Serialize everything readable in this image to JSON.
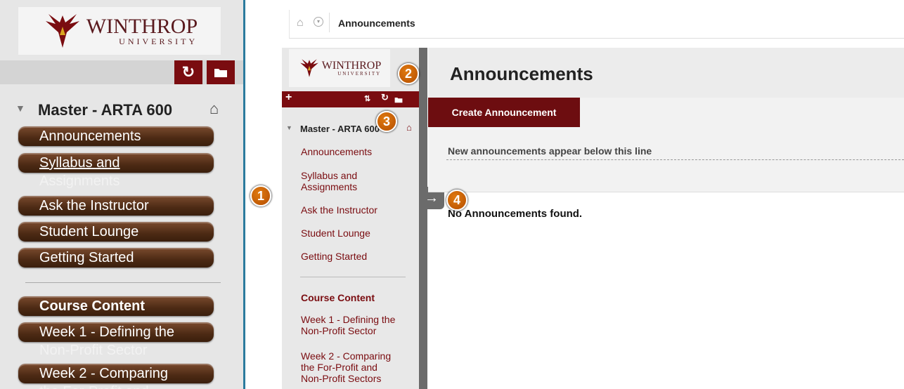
{
  "left_panel": {
    "logo": {
      "name": "WINTHROP",
      "sub": "UNIVERSITY"
    },
    "course_title": "Master - ARTA 600",
    "menu": [
      {
        "line1": "Announcements",
        "line2": ""
      },
      {
        "line1": "Syllabus and",
        "line2": "Assignments"
      },
      {
        "line1": "Ask the Instructor",
        "line2": ""
      },
      {
        "line1": "Student Lounge",
        "line2": ""
      },
      {
        "line1": "Getting Started",
        "line2": ""
      },
      {
        "line1": "Course Content",
        "line2": ""
      },
      {
        "line1": "Week 1 - Defining the",
        "line2": "Non-Profit Sector"
      },
      {
        "line1": "Week 2 - Comparing",
        "line2": "the For-Profit and"
      }
    ]
  },
  "breadcrumb": {
    "current": "Announcements"
  },
  "course_menu": {
    "logo": {
      "name": "WINTHROP",
      "sub": "UNIVERSITY"
    },
    "course_title": "Master - ARTA 600",
    "items": [
      {
        "label": "Announcements"
      },
      {
        "label": "Syllabus and Assignments"
      },
      {
        "label": "Ask the Instructor"
      },
      {
        "label": "Student Lounge"
      },
      {
        "label": "Getting Started"
      }
    ],
    "section_heading": "Course Content",
    "section_items": [
      {
        "label": "Week 1 - Defining the Non-Profit Sector"
      },
      {
        "label": "Week 2 - Comparing the For-Profit and Non-Profit Sectors"
      }
    ]
  },
  "content": {
    "page_title": "Announcements",
    "create_button": "Create Announcement",
    "line_text": "New announcements appear below this line",
    "empty_text": "No Announcements found."
  },
  "callouts": [
    "1",
    "2",
    "3",
    "4"
  ],
  "icons": {
    "refresh": "refresh-icon",
    "folder": "folder-icon",
    "home": "home-icon",
    "add": "plus-icon",
    "sort": "sort-icon",
    "expand": "arrow-right-icon"
  },
  "colors": {
    "maroon": "#7a0c10",
    "brown_button": "#4c2a14",
    "callout": "#d06a0a",
    "border_blue": "#2c7b9e"
  }
}
